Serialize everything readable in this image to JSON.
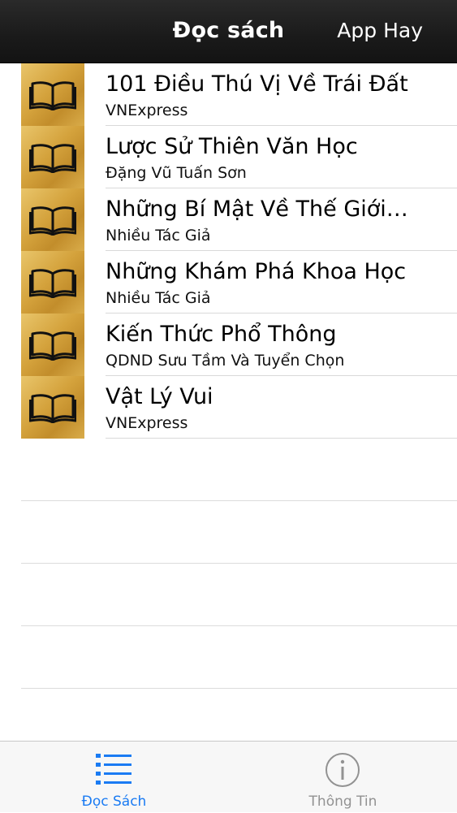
{
  "navbar": {
    "title": "Đọc sách",
    "right_button": "App Hay"
  },
  "books": [
    {
      "title": "101 Điều Thú Vị Về Trái Đất",
      "author": "VNExpress",
      "icon": "book-open-icon"
    },
    {
      "title": "Lược Sử Thiên Văn Học",
      "author": "Đặng Vũ Tuấn Sơn",
      "icon": "book-open-icon"
    },
    {
      "title": "Những Bí Mật Về Thế Giới…",
      "author": "Nhiều Tác Giả",
      "icon": "book-open-icon"
    },
    {
      "title": "Những Khám Phá Khoa Học",
      "author": "Nhiều Tác Giả",
      "icon": "book-open-icon"
    },
    {
      "title": "Kiến Thức Phổ Thông",
      "author": "QDND Sưu Tầm Và Tuyển Chọn",
      "icon": "book-open-icon"
    },
    {
      "title": "Vật Lý Vui",
      "author": "VNExpress",
      "icon": "book-open-icon"
    }
  ],
  "tabbar": {
    "tabs": [
      {
        "label": "Đọc Sách",
        "icon": "list-icon",
        "active": true
      },
      {
        "label": "Thông Tin",
        "icon": "info-icon",
        "active": false
      }
    ]
  },
  "colors": {
    "accent": "#1a7bf3",
    "inactive": "#929292",
    "thumb": "#d4a23c",
    "navbar": "#1a1a1a"
  }
}
